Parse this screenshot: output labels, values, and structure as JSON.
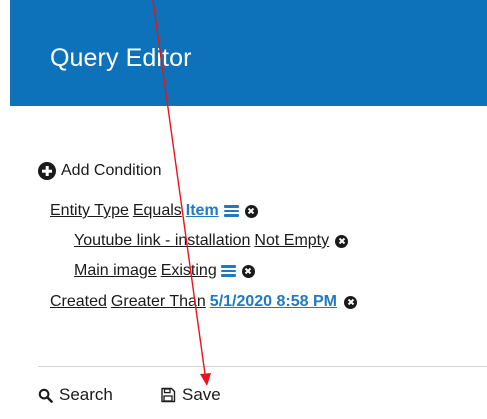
{
  "header": {
    "title": "Query Editor"
  },
  "add_condition": {
    "label": "Add Condition"
  },
  "conditions": [
    {
      "field": "Entity Type",
      "operator": "Equals",
      "value": "Item",
      "has_list": true
    },
    {
      "field": "Youtube link - installation",
      "operator": "Not Empty"
    },
    {
      "field": "Main image",
      "operator": "Existing",
      "has_list": true
    },
    {
      "field": "Created",
      "operator": "Greater Than",
      "value": "5/1/2020 8:58 PM"
    }
  ],
  "footer": {
    "search_label": "Search",
    "save_label": "Save"
  },
  "colors": {
    "header_bg": "#0d72ba",
    "value_link": "#1f7ac4",
    "annotation_arrow": "#e8141c"
  },
  "icons": [
    "plus-circle-icon",
    "list-icon",
    "remove-circle-icon",
    "search-icon",
    "floppy-disk-icon"
  ]
}
